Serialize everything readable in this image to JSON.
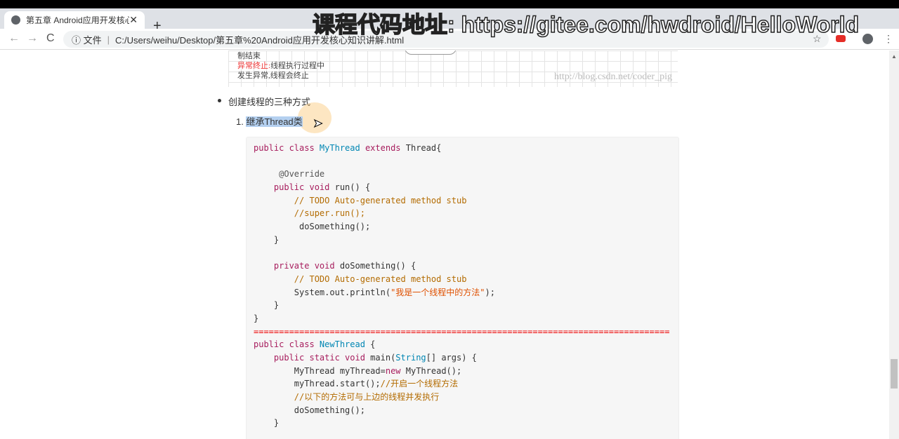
{
  "browser": {
    "tab_title": "第五章 Android应用开发核心知识讲解",
    "tab_close": "✕",
    "new_tab": "+",
    "address_label": "文件",
    "address_url": "C:/Users/weihu/Desktop/第五章%20Android应用开发核心知识讲解.html",
    "back": "←",
    "forward": "→",
    "reload": "C",
    "star": "☆",
    "menu": "⋮"
  },
  "overlay_text": "课程代码地址: https://gitee.com/hwdroid/HelloWorld",
  "diagram": {
    "line1": "制结束",
    "line2_red": "异常终止:",
    "line2": "线程执行过程中",
    "line3": "发生异常,线程会终止",
    "watermark": "http://blog.csdn.net/coder_pig"
  },
  "content": {
    "bullet": "创建线程的三种方式",
    "ol_num": "1.",
    "ol_item": "继承Thread类"
  },
  "code_lines": [
    [
      [
        "k2",
        "public class "
      ],
      [
        "ty",
        "MyThread"
      ],
      [
        "k2",
        " extends "
      ],
      [
        "kw",
        "Thread{"
      ]
    ],
    [],
    [
      [
        "an",
        "     @Override"
      ]
    ],
    [
      [
        "k2",
        "    public void "
      ],
      [
        "kw",
        "run() {"
      ]
    ],
    [
      [
        "cm",
        "        // TODO Auto-generated method stub"
      ]
    ],
    [
      [
        "cm",
        "        //super.run();"
      ]
    ],
    [
      [
        "kw",
        "         doSomething();"
      ]
    ],
    [
      [
        "kw",
        "    }"
      ]
    ],
    [],
    [
      [
        "k2",
        "    private void "
      ],
      [
        "kw",
        "doSomething() {"
      ]
    ],
    [
      [
        "cm",
        "        // TODO Auto-generated method stub"
      ]
    ],
    [
      [
        "kw",
        "        System.out.println("
      ],
      [
        "st",
        "\"我是一个线程中的方法\""
      ],
      [
        "kw",
        ");"
      ]
    ],
    [
      [
        "kw",
        "    }"
      ]
    ],
    [
      [
        "kw",
        "}"
      ]
    ],
    [
      [
        "sep",
        "=================================================================================="
      ]
    ],
    [
      [
        "k2",
        "public class "
      ],
      [
        "ty",
        "NewThread"
      ],
      [
        "kw",
        " {"
      ]
    ],
    [
      [
        "k2",
        "    public static void "
      ],
      [
        "kw",
        "main("
      ],
      [
        "ty",
        "String"
      ],
      [
        "kw",
        "[] args) {"
      ]
    ],
    [
      [
        "kw",
        "        MyThread myThread="
      ],
      [
        "k2",
        "new "
      ],
      [
        "kw",
        "MyThread();"
      ]
    ],
    [
      [
        "kw",
        "        myThread.start();"
      ],
      [
        "cm",
        "//开启一个线程方法"
      ]
    ],
    [
      [
        "cm",
        "        //以下的方法可与上边的线程并发执行"
      ]
    ],
    [
      [
        "kw",
        "        doSomething();"
      ]
    ],
    [
      [
        "kw",
        "    }"
      ]
    ]
  ]
}
